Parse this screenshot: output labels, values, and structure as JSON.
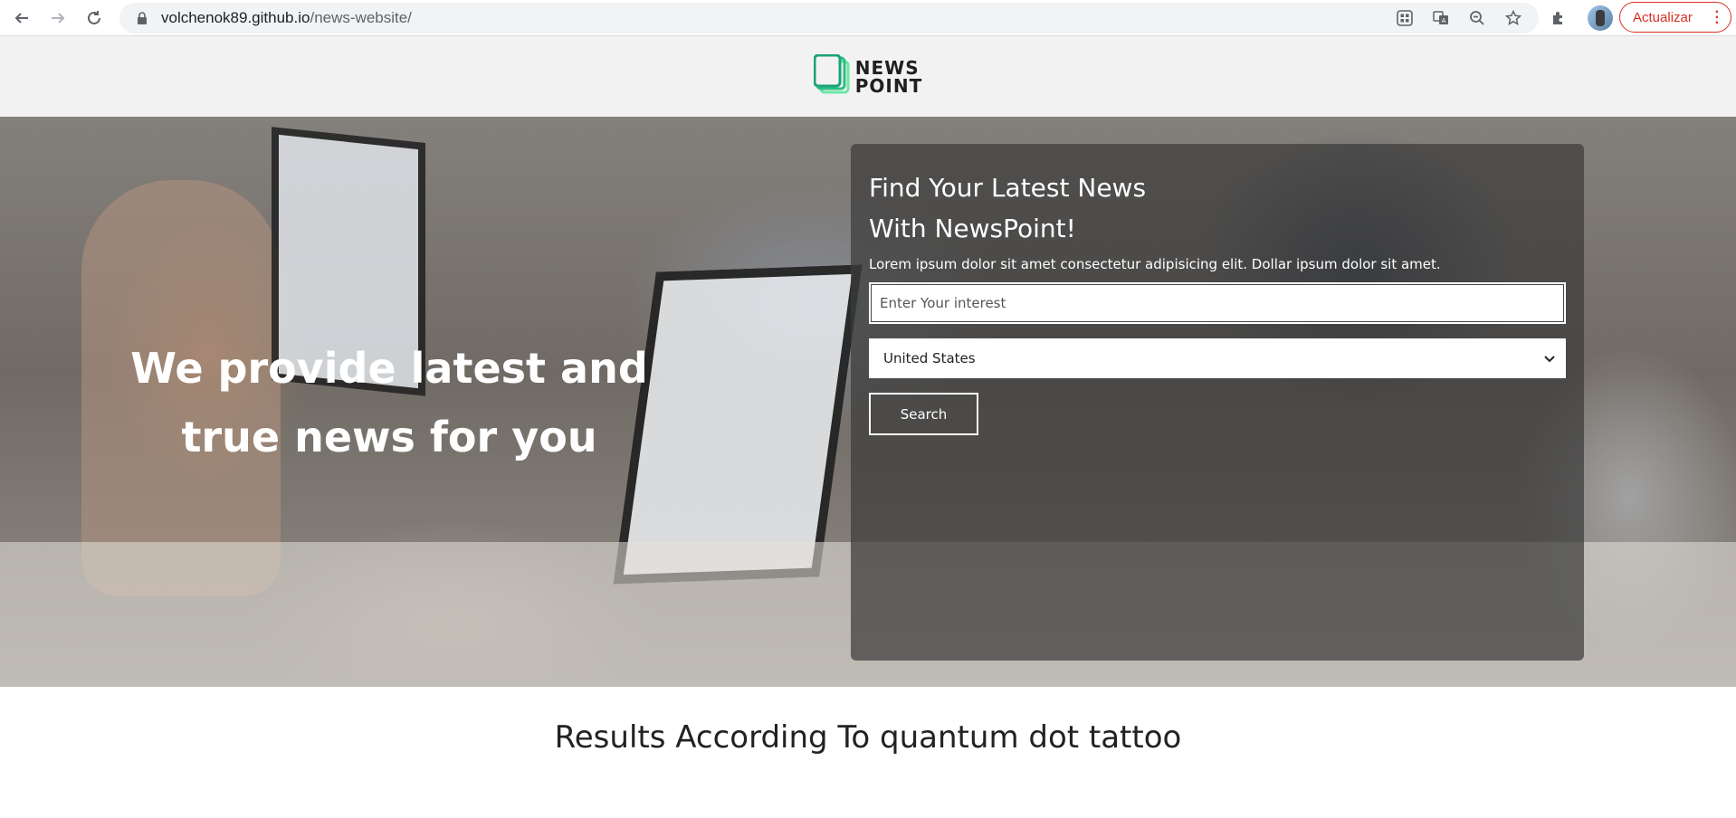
{
  "browser": {
    "url_host": "volchenok89.github.io",
    "url_path": "/news-website/",
    "update_button": "Actualizar"
  },
  "site": {
    "logo_line1": "NEWS",
    "logo_line2": "POINT"
  },
  "hero": {
    "headline": "We provide latest and true news for you",
    "card_title_line1": "Find Your Latest News",
    "card_title_line2": "With NewsPoint!",
    "card_description": "Lorem ipsum dolor sit amet consectetur adipisicing elit. Dollar ipsum dolor sit amet.",
    "interest_placeholder": "Enter Your interest",
    "country_selected": "United States",
    "search_button": "Search"
  },
  "results": {
    "heading": "Results According To quantum dot tattoo"
  },
  "colors": {
    "update_accent": "#d93025",
    "logo_green": "#3ccf8e",
    "header_bg": "#f3f2f2",
    "card_bg": "rgba(60,60,60,0.72)"
  }
}
